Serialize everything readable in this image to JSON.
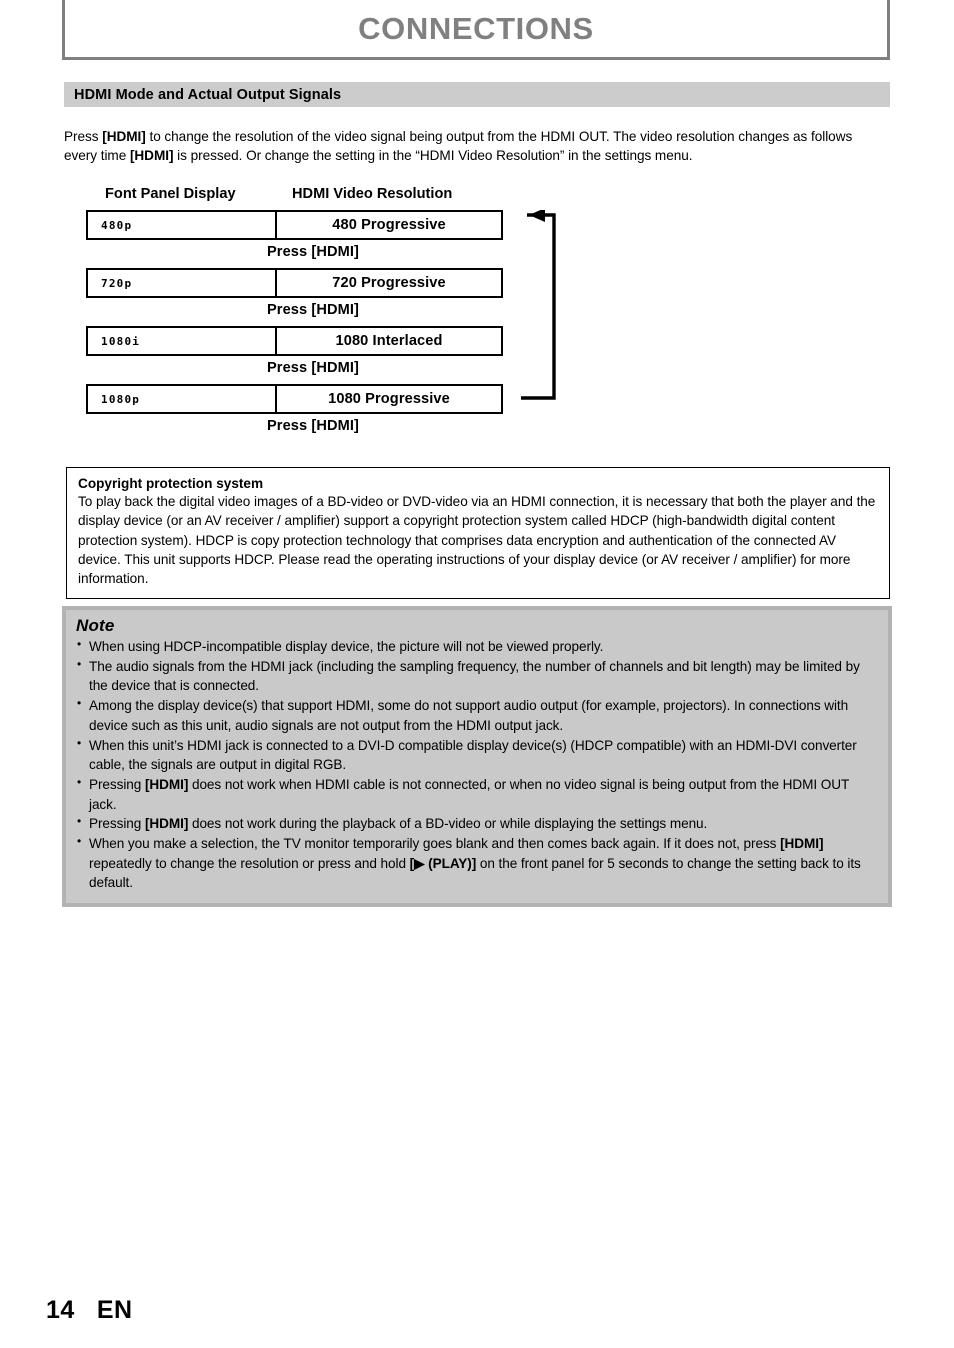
{
  "chapter": {
    "title": "CONNECTIONS",
    "title_color": "#808080"
  },
  "section": {
    "heading": "HDMI Mode and Actual Output Signals",
    "heading_bg": "#cccccc"
  },
  "intro": {
    "part1": "Press ",
    "key1": "[HDMI]",
    "part2": " to change the resolution of the video signal being output from the HDMI OUT. The video resolution changes as follows every time ",
    "key2": "[HDMI]",
    "part3": " is pressed. Or change the setting in the “HDMI Video Resolution” in the settings menu."
  },
  "diagram": {
    "column_headers": {
      "left": "Font Panel Display",
      "right": "HDMI Video Resolution"
    },
    "press_label": "Press [HDMI]",
    "rows": [
      {
        "panel": "480p",
        "resolution": "480 Progressive"
      },
      {
        "panel": "720p",
        "resolution": "720 Progressive"
      },
      {
        "panel": "1080i",
        "resolution": "1080 Interlaced"
      },
      {
        "panel": "1080p",
        "resolution": "1080 Progressive"
      }
    ],
    "loop_arrow": {
      "from_row": "1080 Progressive",
      "to_row": "480 Progressive",
      "direction": "bottom-to-top",
      "color": "#000000"
    }
  },
  "copyright_box": {
    "title": "Copyright protection system",
    "body": "To play back the digital video images of a BD-video or DVD-video via an HDMI connection, it is necessary that both the player and the display device (or an AV receiver / amplifier) support a copyright protection system called HDCP (high-bandwidth digital content protection system). HDCP is copy protection technology that comprises data encryption and authentication of the connected AV device. This unit supports HDCP. Please read the operating instructions of your display device (or AV receiver / amplifier) for more information."
  },
  "note_box": {
    "title": "Note",
    "bg_color": "#c9c9c9",
    "border_color": "#b2b2b2",
    "items": [
      {
        "text": "When using HDCP-incompatible display device, the picture will not be viewed properly."
      },
      {
        "text": "The audio signals from the HDMI jack (including the sampling frequency, the number of channels and bit length) may be limited by the device that is connected."
      },
      {
        "text": "Among the display device(s) that support HDMI, some do not support audio output (for example, projectors). In connections with device such as this unit, audio signals are not output from the HDMI output jack."
      },
      {
        "text": "When this unit’s HDMI jack is connected to a DVI-D compatible display device(s) (HDCP compatible) with an HDMI-DVI  converter cable, the signals are output in digital RGB."
      },
      {
        "pre": "Pressing ",
        "key": "[HDMI]",
        "post": " does not work when HDMI cable is not connected, or when no video signal is being output from the HDMI OUT jack."
      },
      {
        "pre": "Pressing ",
        "key": "[HDMI]",
        "post": " does not work during the playback of a BD-video or while displaying the settings menu."
      },
      {
        "pre": "When you make a selection, the TV monitor temporarily goes blank and then comes back again. If it does not, press ",
        "key": "[HDMI]",
        "post": " repeatedly to change the resolution or press and hold ",
        "key2": "[▶ (PLAY)]",
        "post2": " on the front panel for 5 seconds to change the setting back to its default."
      }
    ]
  },
  "footer": {
    "page_number": "14",
    "language": "EN"
  }
}
